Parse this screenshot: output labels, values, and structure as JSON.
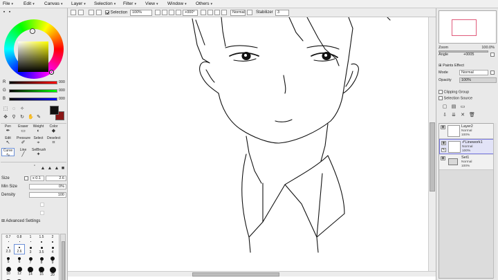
{
  "menu": {
    "items": [
      {
        "label": "File"
      },
      {
        "label": "Edit"
      },
      {
        "label": "Canvas"
      },
      {
        "label": "Layer"
      },
      {
        "label": "Selection"
      },
      {
        "label": "Filter"
      },
      {
        "label": "View"
      },
      {
        "label": "Window"
      },
      {
        "label": "Others"
      }
    ]
  },
  "toolbar": {
    "selection_label": "Selection",
    "zoom_value": "100%",
    "angle_value": "+000°",
    "blend_mode": "Normal",
    "stabilizer_label": "Stabilizer",
    "stabilizer_value": "3"
  },
  "color": {
    "r_label": "R",
    "r_value": "000",
    "g_label": "G",
    "g_value": "000",
    "b_label": "B",
    "b_value": "000",
    "accent": "#6b8fd6"
  },
  "tools": {
    "row1": [
      "Pen",
      "Eraser",
      "Weight",
      "Color"
    ],
    "row2": [
      "Edit",
      "Pressure",
      "Select",
      "Deselect"
    ],
    "row3": [
      "Curve",
      "Line",
      "SelBrush"
    ]
  },
  "brush": {
    "size_label": "Size",
    "size_mult": "x 0.1",
    "size_value": "2.6",
    "min_size_label": "Min Size",
    "min_size_value": "0%",
    "density_label": "Density",
    "density_value": "100",
    "advanced_label": "Advanced Settings",
    "presets": [
      {
        "label": "0.7"
      },
      {
        "label": "0.8"
      },
      {
        "label": "1"
      },
      {
        "label": "1.5"
      },
      {
        "label": "2"
      },
      {
        "label": "2.3"
      },
      {
        "label": "2.6"
      },
      {
        "label": "3"
      },
      {
        "label": "3.5"
      },
      {
        "label": "4"
      },
      {
        "label": "5"
      },
      {
        "label": "6"
      },
      {
        "label": "7"
      },
      {
        "label": "8"
      },
      {
        "label": "9"
      },
      {
        "label": "10"
      },
      {
        "label": "12"
      },
      {
        "label": "14"
      },
      {
        "label": "16"
      },
      {
        "label": "20"
      }
    ]
  },
  "navigator": {
    "zoom_label": "Zoom",
    "zoom_value": "100.0%",
    "angle_label": "Angle",
    "angle_value": "+0005"
  },
  "layers_panel": {
    "paint_effect_label": "Paints Effect",
    "mode_label": "Mode",
    "mode_value": "Normal",
    "opacity_label": "Opacity",
    "opacity_value": "100%",
    "clipping_label": "Clipping Group",
    "selection_source_label": "Selection Source",
    "layers": [
      {
        "name": "Layer2",
        "mode": "Normal",
        "opacity": "100%"
      },
      {
        "name": "Linework1",
        "mode": "Normal",
        "opacity": "100%"
      },
      {
        "name": "Set1",
        "mode": "Normal",
        "opacity": "100%"
      }
    ]
  }
}
